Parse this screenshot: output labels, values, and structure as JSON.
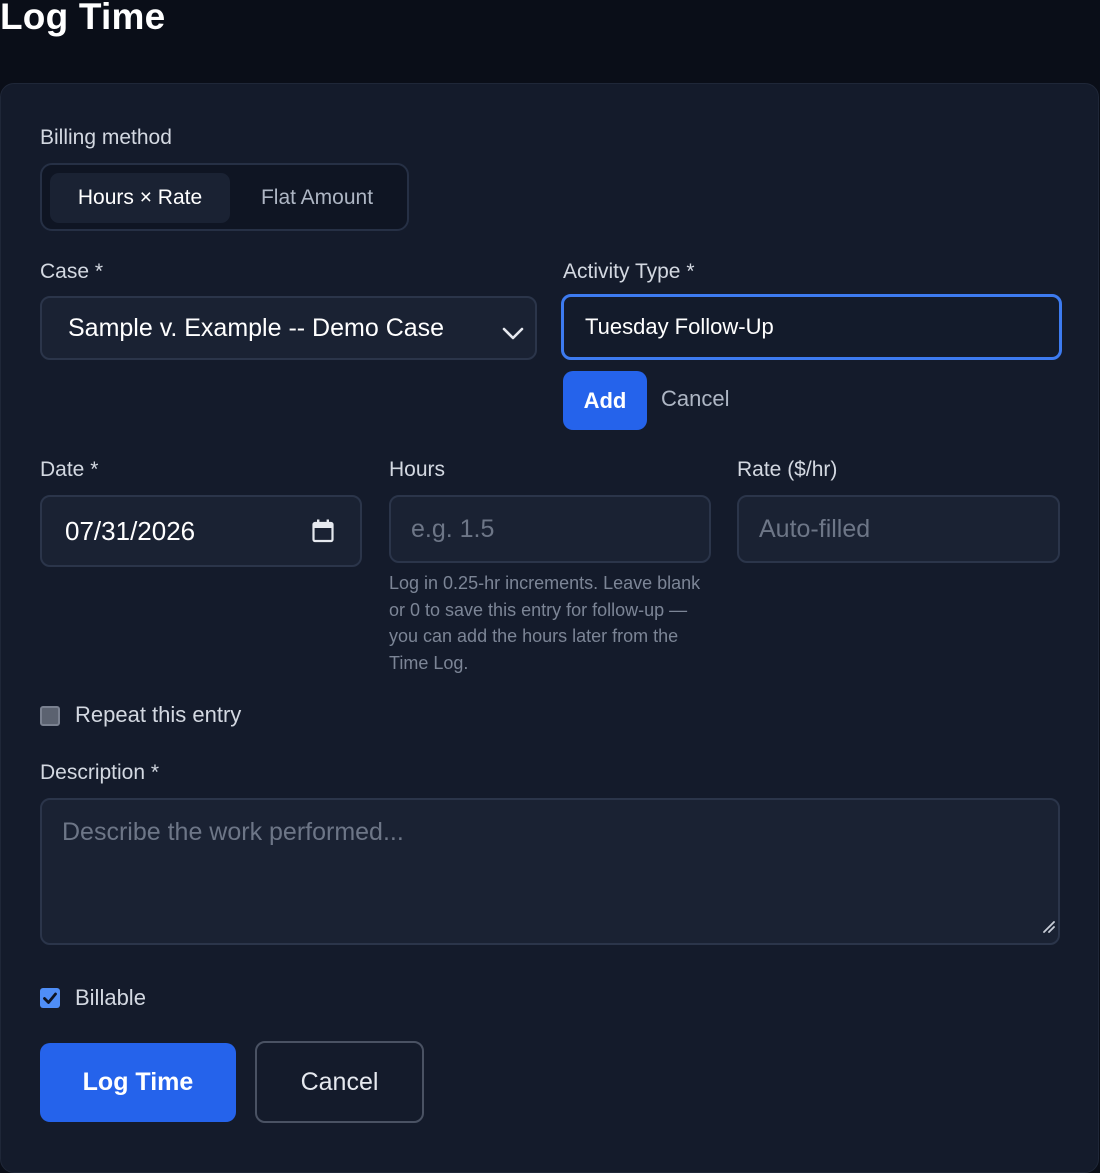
{
  "page": {
    "title": "Log Time"
  },
  "billing": {
    "label": "Billing method",
    "options": [
      "Hours × Rate",
      "Flat Amount"
    ],
    "selected": "Hours × Rate"
  },
  "case": {
    "label": "Case *",
    "value": "Sample v. Example -- Demo Case"
  },
  "activity": {
    "label": "Activity Type *",
    "value": "Tuesday Follow-Up",
    "add_label": "Add",
    "cancel_label": "Cancel"
  },
  "date": {
    "label": "Date *",
    "value": "07/31/2026"
  },
  "hours": {
    "label": "Hours",
    "placeholder": "e.g. 1.5",
    "hint": "Log in 0.25-hr increments. Leave blank or 0 to save this entry for follow-up — you can add the hours later from the Time Log."
  },
  "rate": {
    "label": "Rate ($/hr)",
    "placeholder": "Auto-filled"
  },
  "repeat": {
    "label": "Repeat this entry",
    "checked": false
  },
  "description": {
    "label": "Description *",
    "placeholder": "Describe the work performed..."
  },
  "billable": {
    "label": "Billable",
    "checked": true
  },
  "actions": {
    "submit_label": "Log Time",
    "cancel_label": "Cancel"
  },
  "colors": {
    "accent": "#2563eb",
    "card_bg": "#141b2b",
    "page_bg": "#0a0e18",
    "field_bg": "#1a2233"
  },
  "icons": {
    "case_dropdown": "chevron-down-icon",
    "date_picker": "calendar-icon",
    "billable_check": "check-icon",
    "textarea_resize": "resize-handle-icon"
  }
}
